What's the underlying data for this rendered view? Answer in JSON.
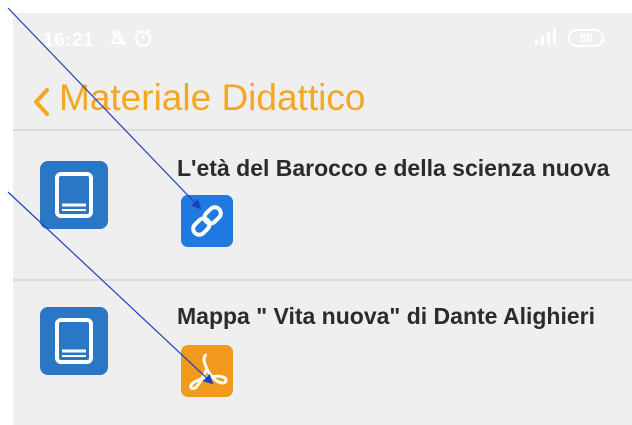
{
  "status_bar": {
    "time": "16:21",
    "battery": "88",
    "icons": [
      "mute-icon",
      "alarm-icon",
      "signal-icon",
      "battery-icon"
    ]
  },
  "header": {
    "back_icon": "chevron-left-icon",
    "title": "Materiale Didattico"
  },
  "items": [
    {
      "title": "L'età del Barocco e della scienza nuova",
      "icon": "book-icon",
      "attachment": "link-icon"
    },
    {
      "title": "Mappa \" Vita nuova\" di Dante Alighieri",
      "icon": "book-icon",
      "attachment": "pdf-icon"
    }
  ],
  "colors": {
    "accent": "#f6a623",
    "book_icon_bg": "#2a78c5",
    "link_bg": "#1e7ae0",
    "pdf_bg": "#f29a1e",
    "background": "#efefef",
    "annotation_line": "#1f3fbf"
  }
}
